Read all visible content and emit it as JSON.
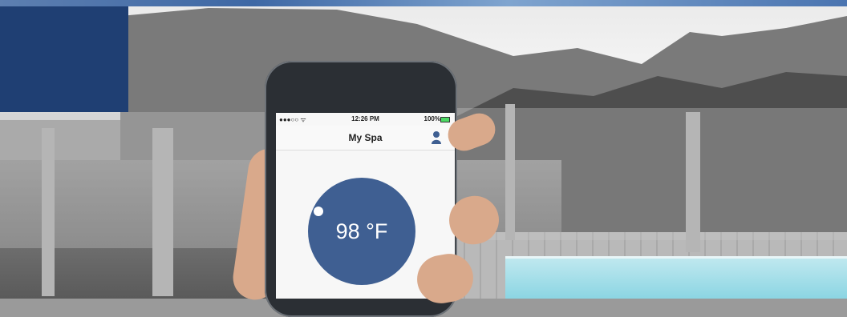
{
  "app": {
    "status_carrier": "●●●○○ ᯤ",
    "status_time": "12:26 PM",
    "status_battery": "100%",
    "title": "My Spa",
    "temperature": "98 °F"
  },
  "colors": {
    "accent": "#3f5f92",
    "battery": "#4cd964"
  },
  "icons": {
    "user": "user-icon"
  }
}
